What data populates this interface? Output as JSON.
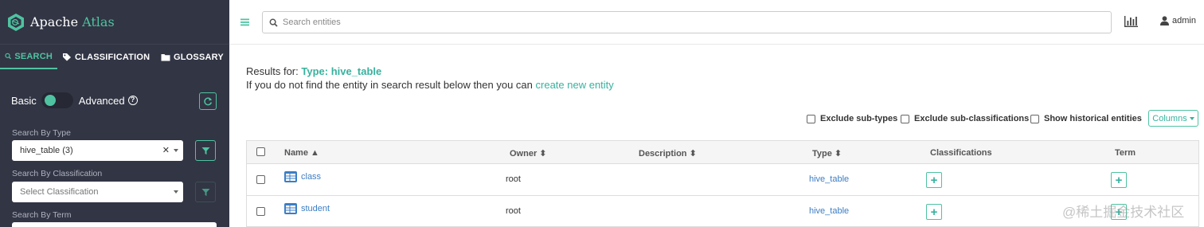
{
  "brand": {
    "name_prefix": "Apache",
    "name_suffix": "Atlas"
  },
  "sidebar": {
    "tabs": [
      {
        "label": "SEARCH",
        "icon": "search-icon",
        "active": true
      },
      {
        "label": "CLASSIFICATION",
        "icon": "tag-icon",
        "active": false
      },
      {
        "label": "GLOSSARY",
        "icon": "folder-icon",
        "active": false
      }
    ],
    "mode_basic": "Basic",
    "mode_advanced": "Advanced",
    "search_by_type_label": "Search By Type",
    "search_by_type_value": "hive_table (3)",
    "search_by_classification_label": "Search By Classification",
    "search_by_classification_placeholder": "Select Classification",
    "search_by_term_label": "Search By Term"
  },
  "header": {
    "search_placeholder": "Search entities",
    "user": "admin"
  },
  "results": {
    "prefix": "Results for:",
    "query": "Type: hive_table",
    "hint_text": "If you do not find the entity in search result below then you can",
    "hint_link": "create new entity"
  },
  "options": {
    "exclude_sub_types": "Exclude sub-types",
    "exclude_sub_classifications": "Exclude sub-classifications",
    "show_historical": "Show historical entities",
    "columns_button": "Columns"
  },
  "table": {
    "headers": {
      "name": "Name",
      "owner": "Owner",
      "description": "Description",
      "type": "Type",
      "classifications": "Classifications",
      "term": "Term"
    },
    "rows": [
      {
        "name": "class",
        "owner": "root",
        "description": "",
        "type": "hive_table"
      },
      {
        "name": "student",
        "owner": "root",
        "description": "",
        "type": "hive_table"
      }
    ]
  },
  "watermark": "@稀土掘金技术社区",
  "colors": {
    "sidebar_bg": "#323544",
    "accent": "#4fc3a1",
    "link": "#3c7ec4"
  }
}
